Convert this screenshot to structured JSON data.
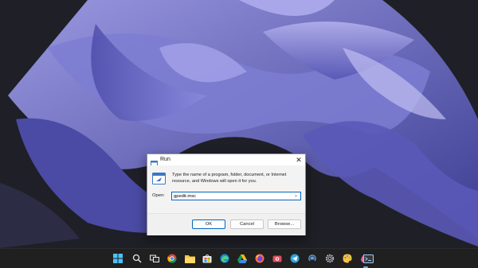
{
  "run_dialog": {
    "title": "Run",
    "close_glyph": "✕",
    "description": "Type the name of a program, folder, document, or Internet resource, and Windows will open it for you.",
    "open_label": "Open:",
    "open_value": "gpedit.msc",
    "combo_arrow": "⌄",
    "buttons": {
      "ok": "OK",
      "cancel": "Cancel",
      "browse": "Browse..."
    }
  },
  "taskbar": {
    "icons": [
      "windows-start-icon",
      "search-icon",
      "task-view-icon",
      "chrome-icon",
      "file-explorer-icon",
      "store-icon",
      "edge-icon",
      "drive-icon",
      "firefox-icon",
      "camera-icon",
      "telegram-icon",
      "podcast-icon",
      "settings-icon",
      "paint-icon",
      "app-droplet-icon",
      "terminal-icon"
    ]
  },
  "colors": {
    "desktop_bg": "#22232a",
    "wallpaper_purple": "#6a6bc4",
    "accent": "#0067c0",
    "taskbar_bg": "#202020"
  }
}
